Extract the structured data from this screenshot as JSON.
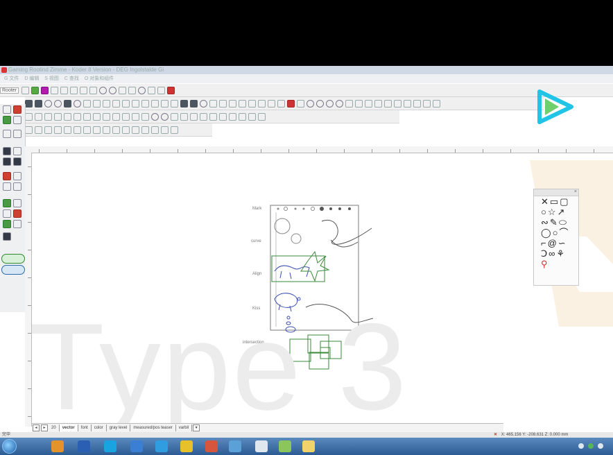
{
  "app": {
    "title": "Gaming Rootind Zimme - Koder 8 Version - DEG Ingolstalde Gi",
    "menu": [
      "G 文件",
      "D 编辑",
      "S 视图",
      "C 查找",
      "O 对象和组件"
    ]
  },
  "toolbar": {
    "root_label": "Rooter"
  },
  "canvas": {
    "watermark": "Type 3",
    "labels": {
      "mark": "Mark",
      "curve": "curve",
      "align": "Align",
      "kiss": "Kiss",
      "intersection": "intersection"
    }
  },
  "sheet_tabs": {
    "page": "20",
    "tabs": [
      "vector",
      "font",
      "color",
      "gray level",
      "measured/pos teaser",
      "varbil"
    ],
    "active": "vector"
  },
  "status": {
    "left": "完毕",
    "x": "X: 465.156",
    "y": "Y: -208.631",
    "z": "Z: 0.000 mm"
  },
  "colors": {
    "accent_green": "#2f8a3a",
    "drawing_blue": "#3a4fb0",
    "logo_cyan": "#22c4e6",
    "logo_orange": "#f1a22f"
  },
  "icons": [
    "start-orb-icon",
    "outlook-icon",
    "word-icon",
    "skype-icon",
    "explorer-icon",
    "safari-icon",
    "chrome-icon",
    "app-icon",
    "calculator-icon",
    "paint-icon",
    "folder-icon"
  ]
}
